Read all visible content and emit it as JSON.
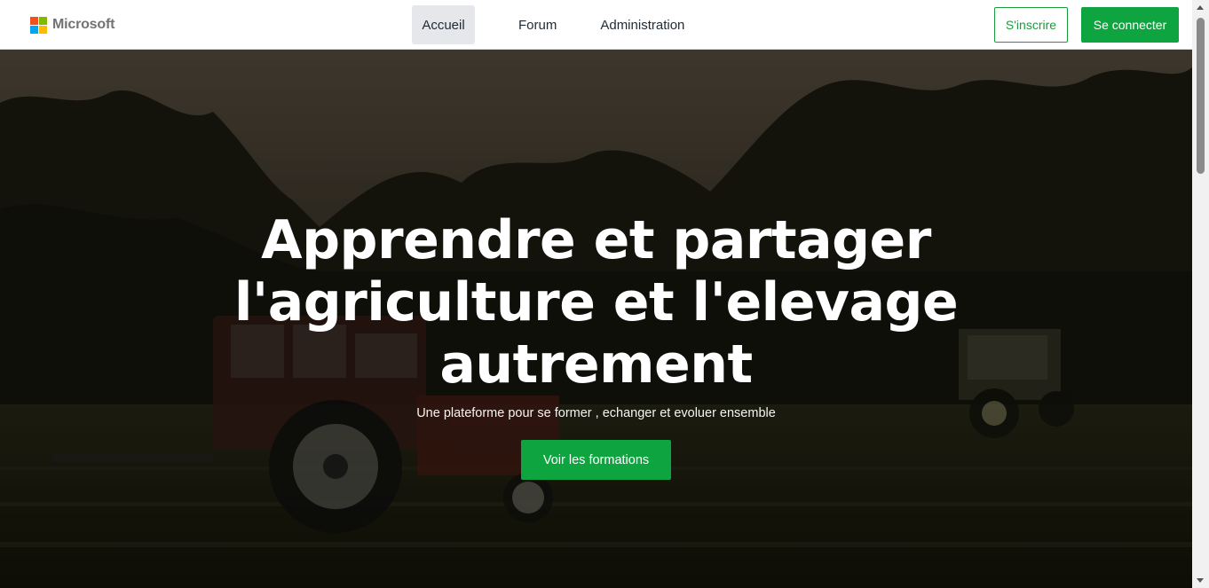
{
  "brand": {
    "name": "Microsoft",
    "logo_icon": "microsoft-logo-icon"
  },
  "nav": {
    "items": [
      {
        "label": "Accueil",
        "active": true
      },
      {
        "label": "Forum",
        "active": false
      },
      {
        "label": "Administration",
        "active": false
      }
    ]
  },
  "auth": {
    "signup_label": "S'inscrire",
    "login_label": "Se connecter"
  },
  "hero": {
    "title_lines": [
      "Apprendre et partager",
      "l'agriculture et l'elevage",
      "autrement"
    ],
    "subtitle": "Une plateforme pour se former , echanger et evoluer ensemble",
    "cta_label": "Voir les formations",
    "background": "farm-field-with-tractors-photo"
  },
  "colors": {
    "accent": "#0ea43f",
    "accent_outline": "#1a9c3e",
    "nav_active_bg": "#e6e7ea"
  }
}
